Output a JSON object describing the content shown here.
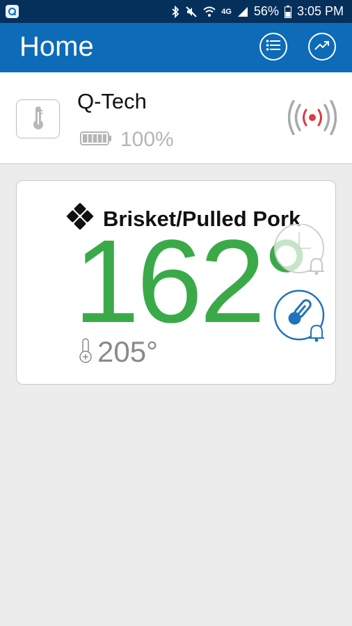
{
  "status_bar": {
    "network": "4G",
    "battery_percent": "56%",
    "time": "3:05 PM",
    "icons": [
      "app-icon",
      "bluetooth-icon",
      "mute-icon",
      "wifi-icon",
      "cell-signal-icon",
      "battery-icon"
    ]
  },
  "app_bar": {
    "title": "Home",
    "icons": [
      "list-icon",
      "trend-chart-icon"
    ]
  },
  "device": {
    "name": "Q-Tech",
    "battery_label": "100%",
    "battery_level": 1.0,
    "icons": [
      "thermometer-icon",
      "battery-icon",
      "signal-broadcast-icon"
    ]
  },
  "probe": {
    "name": "Brisket/Pulled Pork",
    "current_temp": "162°",
    "target_temp": "205°",
    "icons": [
      "probe-diamond-icon",
      "timer-alarm-icon",
      "temperature-alarm-icon",
      "target-thermometer-icon"
    ]
  },
  "colors": {
    "status_bar": "#05305c",
    "app_bar": "#0d6bb8",
    "current_temp": "#3aaa49",
    "alarm_active": "#1f74bd",
    "signal_dot": "#e0393e"
  }
}
